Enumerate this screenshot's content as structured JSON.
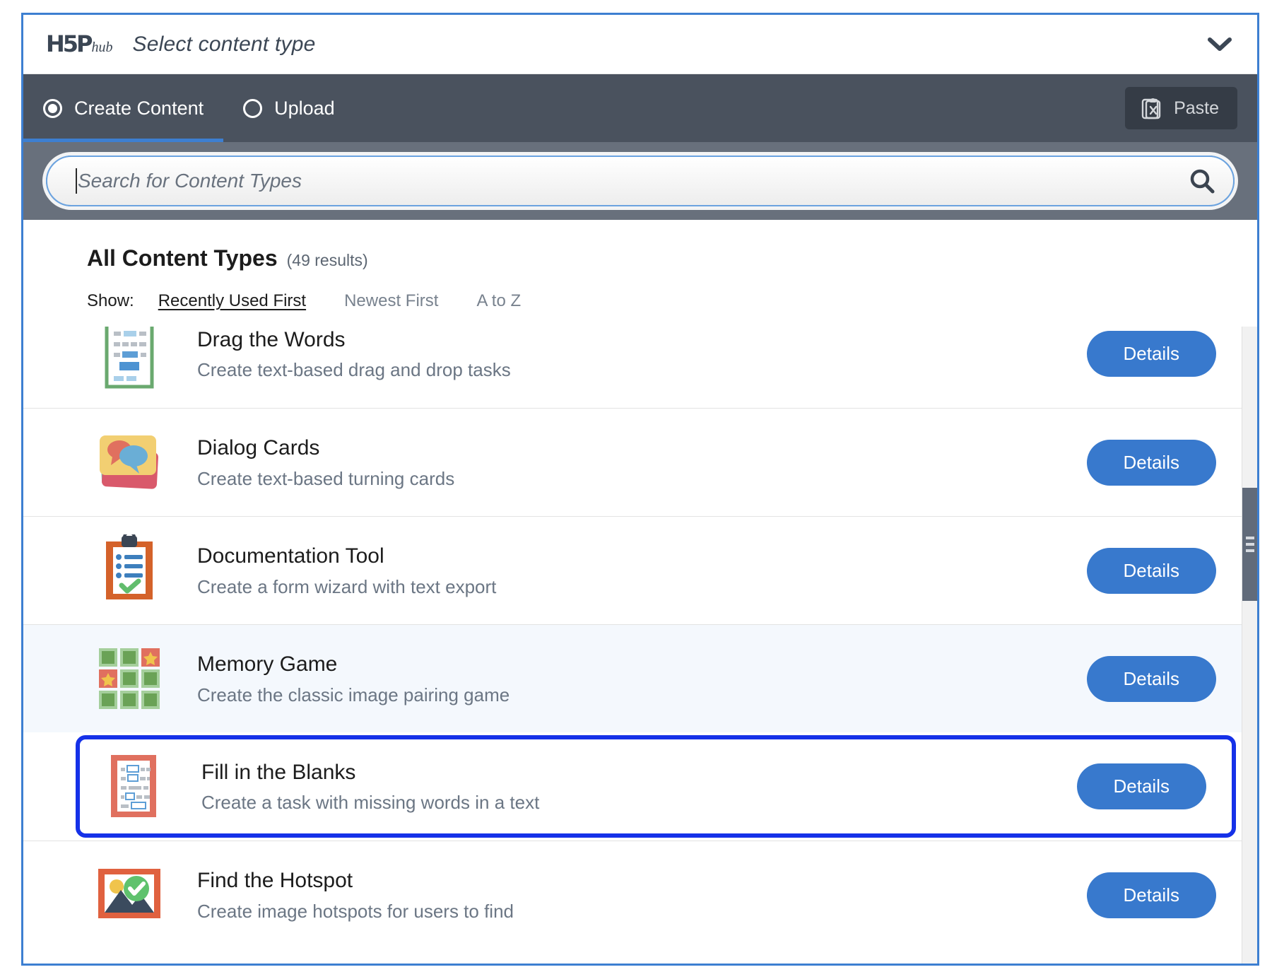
{
  "header": {
    "logo_main": "H5P",
    "logo_sub": "hub",
    "title": "Select content type",
    "chevron_icon": "chevron-down-icon"
  },
  "toolbar": {
    "tabs": [
      {
        "label": "Create Content",
        "selected": true
      },
      {
        "label": "Upload",
        "selected": false
      }
    ],
    "paste_label": "Paste",
    "paste_icon": "clipboard-x-icon"
  },
  "search": {
    "placeholder": "Search for Content Types",
    "value": "",
    "icon": "search-icon",
    "focused": true
  },
  "results": {
    "title": "All Content Types",
    "count_label": "(49 results)",
    "show_label": "Show:",
    "sort_options": [
      {
        "label": "Recently Used First",
        "active": true
      },
      {
        "label": "Newest First",
        "active": false
      },
      {
        "label": "A to Z",
        "active": false
      }
    ]
  },
  "content_types": [
    {
      "title": "Drag the Words",
      "description": "Create text-based drag and drop tasks",
      "details_label": "Details",
      "icon": "drag-the-words-icon",
      "state": "normal"
    },
    {
      "title": "Dialog Cards",
      "description": "Create text-based turning cards",
      "details_label": "Details",
      "icon": "dialog-cards-icon",
      "state": "normal"
    },
    {
      "title": "Documentation Tool",
      "description": "Create a form wizard with text export",
      "details_label": "Details",
      "icon": "documentation-tool-icon",
      "state": "normal"
    },
    {
      "title": "Memory Game",
      "description": "Create the classic image pairing game",
      "details_label": "Details",
      "icon": "memory-game-icon",
      "state": "highlighted"
    },
    {
      "title": "Fill in the Blanks",
      "description": "Create a task with missing words in a text",
      "details_label": "Details",
      "icon": "fill-in-the-blanks-icon",
      "state": "selected"
    },
    {
      "title": "Find the Hotspot",
      "description": "Create image hotspots for users to find",
      "details_label": "Details",
      "icon": "find-the-hotspot-icon",
      "state": "normal"
    }
  ],
  "colors": {
    "accent_blue": "#3879cd",
    "selection_blue": "#1531e8",
    "toolbar_dark": "#4a525e",
    "search_band": "#68707c",
    "page_border": "#3d7fd1"
  }
}
